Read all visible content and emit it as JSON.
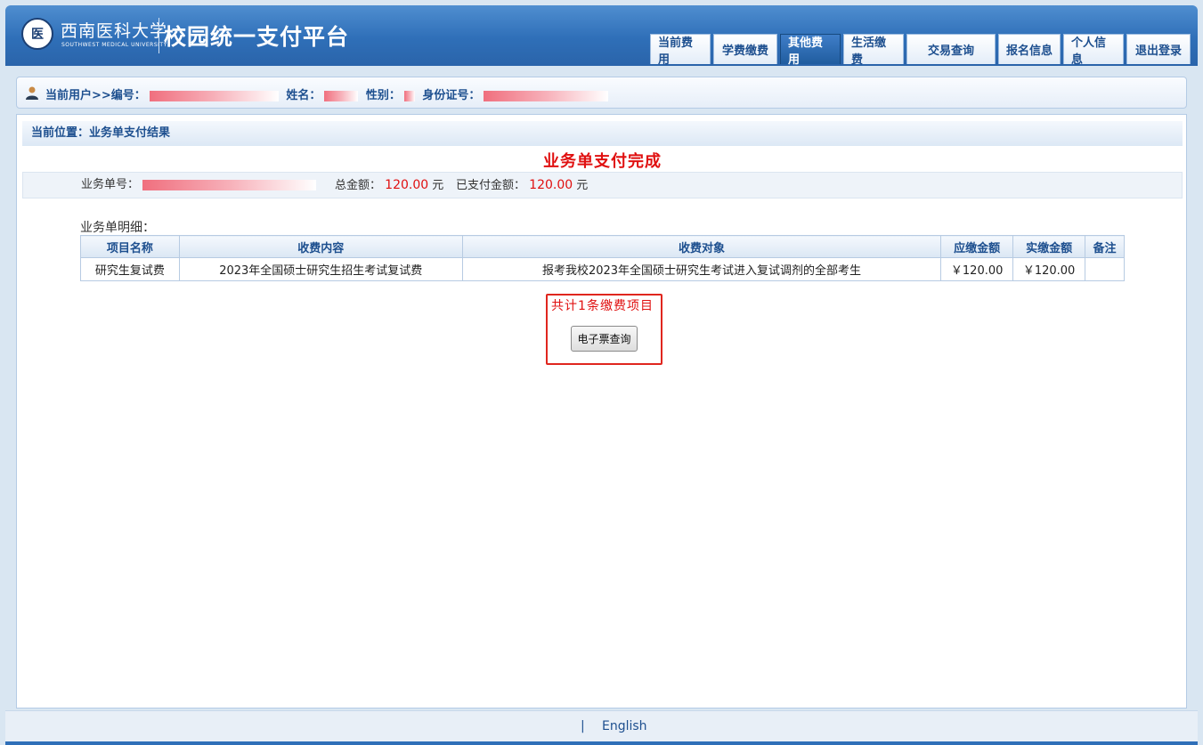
{
  "header": {
    "logo_cn": "西南医科大学",
    "logo_en": "SOUTHWEST MEDICAL UNIVERSITY",
    "title": "校园统一支付平台"
  },
  "nav": {
    "tabs": [
      {
        "label": "当前费用",
        "active": false
      },
      {
        "label": "学费缴费",
        "active": false
      },
      {
        "label": "其他费用",
        "active": true
      },
      {
        "label": "生活缴费",
        "active": false
      },
      {
        "label": "交易查询",
        "active": false
      },
      {
        "label": "报名信息",
        "active": false
      },
      {
        "label": "个人信息",
        "active": false
      },
      {
        "label": "退出登录",
        "active": false
      }
    ]
  },
  "user_bar": {
    "prefix": "当前用户>>编号：",
    "name_label": "姓名：",
    "gender_label": "性别：",
    "id_label": "身份证号："
  },
  "main": {
    "location": "当前位置：业务单支付结果",
    "result_title": "业务单支付完成",
    "order_no_label": "业务单号：",
    "total_label": "总金额：",
    "total_value": "120.00",
    "paid_label": "已支付金额：",
    "paid_value": "120.00",
    "currency_unit": "元",
    "detail_label": "业务单明细：",
    "table": {
      "headers": [
        "项目名称",
        "收费内容",
        "收费对象",
        "应缴金额",
        "实缴金额",
        "备注"
      ],
      "rows": [
        [
          "研究生复试费",
          "2023年全国硕士研究生招生考试复试费",
          "报考我校2023年全国硕士研究生考试进入复试调剂的全部考生",
          "￥120.00",
          "￥120.00",
          ""
        ]
      ]
    },
    "count_text": "共计1条缴费项目",
    "einvoice_button": "电子票查询"
  },
  "footer": {
    "separator": "|",
    "english_link": "English"
  },
  "colors": {
    "header_blue": "#2f6fb8",
    "accent_red": "#e01010",
    "nav_text": "#1d4f8f"
  }
}
